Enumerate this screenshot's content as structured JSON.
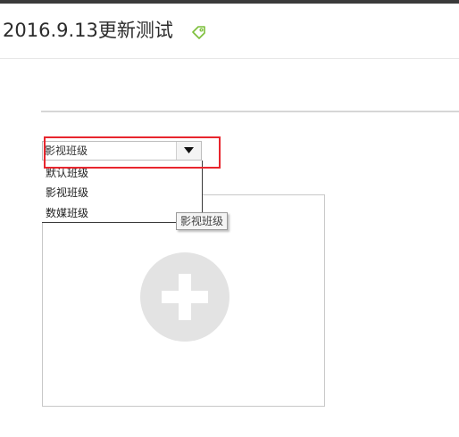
{
  "page": {
    "title": "2016.9.13更新测试",
    "title_icon": "tag-icon",
    "accent_color": "#e8262e",
    "icon_color": "#7cbf3a"
  },
  "class_select": {
    "selected": "影视班级",
    "arrow_icon": "triangle-down-icon",
    "options": [
      "默认班级",
      "影视班级",
      "数媒班级"
    ]
  },
  "upload": {
    "icon": "plus-icon"
  },
  "tooltip": {
    "text": "影视班级"
  }
}
